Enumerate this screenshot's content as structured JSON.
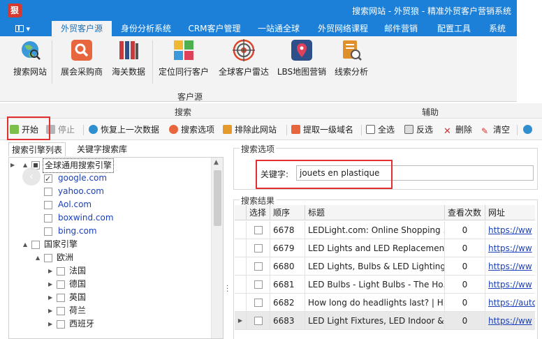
{
  "window": {
    "logo": "狠",
    "title": "搜索网站 - 外贸狼 - 精准外贸客户营销系统"
  },
  "ribbon_tabs": [
    "外贸客户源",
    "身份分析系统",
    "CRM客户管理",
    "一站通全球",
    "外贸网络课程",
    "邮件营销",
    "配置工具",
    "系统"
  ],
  "ribbon_buttons": [
    {
      "label": "搜索网站",
      "icon": "globe-search-icon",
      "color": "#3a9ad9"
    },
    {
      "label": "展会采购商",
      "icon": "magnifier-icon",
      "color": "#e8663d"
    },
    {
      "label": "海关数据",
      "icon": "binders-icon",
      "color": "#c93b3b"
    },
    {
      "label": "定位同行客户",
      "icon": "tiles-icon",
      "color": "#4caf50"
    },
    {
      "label": "全球客户雷达",
      "icon": "radar-icon",
      "color": "#d9462b"
    },
    {
      "label": "LBS地图营销",
      "icon": "map-pin-icon",
      "color": "#2d4f8a"
    },
    {
      "label": "线索分析",
      "icon": "clue-icon",
      "color": "#e0902a"
    }
  ],
  "ribbon_group_label": "客户源",
  "sections": {
    "search": "搜索",
    "assist": "辅助"
  },
  "toolbar": {
    "start": "开始",
    "stop": "停止",
    "restore": "恢复上一次数据",
    "options": "搜索选项",
    "exclude": "排除此网站",
    "extract": "提取一级域名",
    "select_all": "全选",
    "invert": "反选",
    "delete": "删除",
    "clear": "清空"
  },
  "left_tabs": [
    "搜索引擎列表",
    "关键字搜索库"
  ],
  "tree": [
    {
      "label": "全球通用搜索引擎",
      "level": 0,
      "arrow": "▲",
      "check": "partial",
      "selected": true,
      "link": false
    },
    {
      "label": "google.com",
      "level": 1,
      "check": "checked",
      "link": true
    },
    {
      "label": "yahoo.com",
      "level": 1,
      "check": "none",
      "link": true
    },
    {
      "label": "Aol.com",
      "level": 1,
      "check": "none",
      "link": true
    },
    {
      "label": "boxwind.com",
      "level": 1,
      "check": "none",
      "link": true
    },
    {
      "label": "bing.com",
      "level": 1,
      "check": "none",
      "link": true
    },
    {
      "label": "国家引擎",
      "level": 0,
      "arrow": "▲",
      "check": "none",
      "link": false
    },
    {
      "label": "欧洲",
      "level": 1,
      "arrow": "▲",
      "check": "none",
      "link": false
    },
    {
      "label": "法国",
      "level": 2,
      "arrow": "▶",
      "check": "none",
      "link": false
    },
    {
      "label": "德国",
      "level": 2,
      "arrow": "▶",
      "check": "none",
      "link": false
    },
    {
      "label": "英国",
      "level": 2,
      "arrow": "▶",
      "check": "none",
      "link": false
    },
    {
      "label": "荷兰",
      "level": 2,
      "arrow": "▶",
      "check": "none",
      "link": false
    },
    {
      "label": "西班牙",
      "level": 2,
      "arrow": "▶",
      "check": "none",
      "link": false
    }
  ],
  "search_options": {
    "legend": "搜索选项",
    "keyword_label": "关键字:",
    "keyword_value": "jouets en plastique"
  },
  "results": {
    "legend": "搜索结果",
    "columns": [
      "选择",
      "顺序",
      "标题",
      "查看次数",
      "网址"
    ],
    "rows": [
      {
        "order": "6678",
        "title": "LEDLight.com: Online Shopping ...",
        "views": "0",
        "url": "https://ww"
      },
      {
        "order": "6679",
        "title": "LED Lights and LED Replacemen...",
        "views": "0",
        "url": "https://ww"
      },
      {
        "order": "6680",
        "title": "LED Lights, Bulbs & LED Lighting...",
        "views": "0",
        "url": "https://ww"
      },
      {
        "order": "6681",
        "title": "LED Bulbs - Light Bulbs - The Ho...",
        "views": "0",
        "url": "https://ww"
      },
      {
        "order": "6682",
        "title": "How long do headlights last? | H...",
        "views": "0",
        "url": "https://auto"
      },
      {
        "order": "6683",
        "title": "LED Light Fixtures, LED Indoor &...",
        "views": "0",
        "url": "https://ww"
      }
    ]
  }
}
